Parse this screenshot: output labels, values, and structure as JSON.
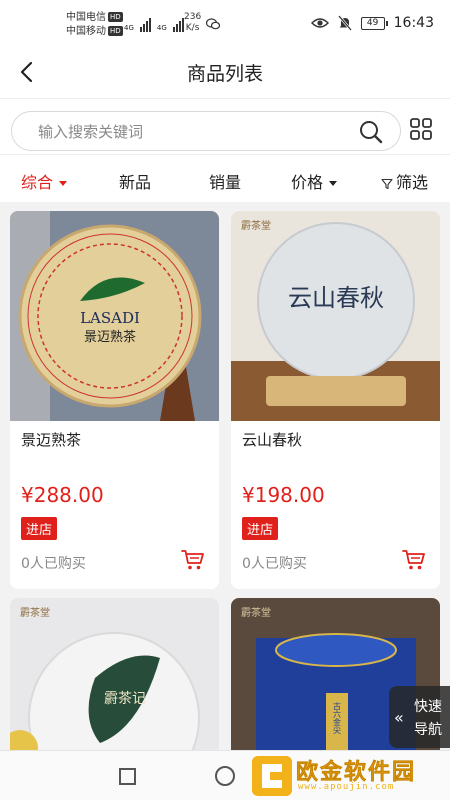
{
  "status_bar": {
    "carrier1": "中国电信",
    "carrier2": "中国移动",
    "hd_badge": "HD",
    "net1": "4G",
    "net2": "4G",
    "speed_value": "236",
    "speed_unit": "K/s",
    "battery": "49",
    "time": "16:43"
  },
  "header": {
    "title": "商品列表"
  },
  "search": {
    "placeholder": "输入搜索关键词"
  },
  "filters": {
    "comprehensive": "综合",
    "new": "新品",
    "sales": "销量",
    "price": "价格",
    "filter": "筛选"
  },
  "colors": {
    "accent": "#e0211b",
    "watermark": "#f3b21a"
  },
  "products": [
    {
      "name": "景迈熟茶",
      "price": "¥288.00",
      "tag": "进店",
      "sold": "0人已购买",
      "wrapper_brand": "LASADI",
      "wrapper_text": "景迈熟茶"
    },
    {
      "name": "云山春秋",
      "price": "¥198.00",
      "tag": "进店",
      "sold": "0人已购买",
      "wrapper_brand": "霨茶堂",
      "wrapper_text": "云山春秋"
    },
    {
      "name": "",
      "price": "",
      "tag": "",
      "sold": "",
      "wrapper_brand": "霨茶堂",
      "wrapper_text": "霨茶记"
    },
    {
      "name": "",
      "price": "",
      "tag": "",
      "sold": "",
      "wrapper_brand": "霨茶堂",
      "wrapper_text": "古六金尖"
    }
  ],
  "quick_nav": {
    "line1": "快速",
    "line2": "导航"
  },
  "watermark": {
    "text": "欧金软件园",
    "url": "www.apoujin.com"
  }
}
